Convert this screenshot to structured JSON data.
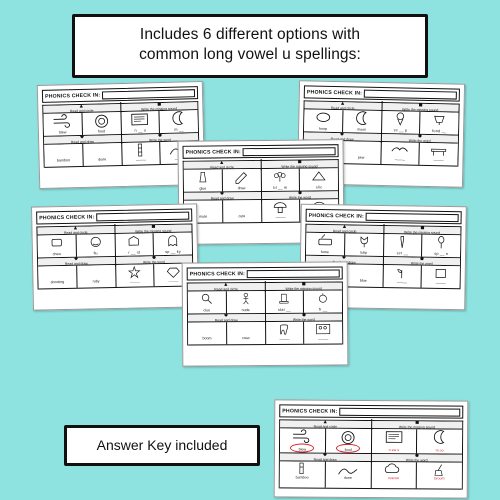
{
  "banner": {
    "line1": "Includes 6 different options with",
    "line2": "common long vowel u spellings:"
  },
  "answer_key": {
    "label": "Answer Key included"
  },
  "sheet_common": {
    "title": "PHONICS CHECK IN:",
    "header_read_circle": "Read and circle",
    "header_missing_sound": "Write the missing sound",
    "header_read_draw": "Read and draw",
    "header_write_word": "Write the word",
    "icons": {
      "triangle": "triangle-icon",
      "square": "square-icon",
      "heart": "heart-icon",
      "circle": "circle-icon"
    }
  },
  "sheets": [
    {
      "id": "sheet-ew",
      "top_words": [
        "blew",
        "food"
      ],
      "missing": [
        "n __ s",
        "m __"
      ],
      "bottom_words": [
        "bamboo",
        "dune"
      ],
      "top_pics": [
        "wind-blowing",
        "food-plate"
      ],
      "bottom_pics": [
        "bamboo",
        "sand-dune"
      ]
    },
    {
      "id": "sheet-oo",
      "top_words": [
        "hoop",
        "moon"
      ],
      "missing": [
        "sc __ p",
        "fond __"
      ],
      "bottom_words": [
        "flew",
        "pew"
      ],
      "top_pics": [
        "hoop",
        "moon"
      ],
      "bottom_pics": [
        "bird-flying",
        "bench"
      ]
    },
    {
      "id": "sheet-ue",
      "top_words": [
        "glue",
        "draw"
      ],
      "missing": [
        "bl __ m",
        "slic"
      ],
      "bottom_words": [
        "mute",
        "cute"
      ],
      "top_pics": [
        "glue-bottle",
        "drawing"
      ],
      "bottom_pics": [
        "mushroom",
        "mushroom-2"
      ]
    },
    {
      "id": "sheet-ew2",
      "top_words": [
        "chew",
        "flu"
      ],
      "missing": [
        "r __ st",
        "sp __ ky"
      ],
      "bottom_words": [
        "shooting",
        "ruby"
      ],
      "top_pics": [
        "chewing-gum",
        "sick-face"
      ],
      "bottom_pics": [
        "shooting-star",
        "ruby-gem"
      ]
    },
    {
      "id": "sheet-u-e",
      "top_words": [
        "fume",
        "tulip"
      ],
      "missing": [
        "scr __",
        "sp __ n"
      ],
      "bottom_words": [
        "grew",
        "blue"
      ],
      "top_pics": [
        "fumes",
        "tulip"
      ],
      "bottom_pics": [
        "plant-growing",
        "blue-swatch"
      ]
    },
    {
      "id": "sheet-ui",
      "top_words": [
        "clue",
        "nude"
      ],
      "missing": [
        "stat __",
        "fr __"
      ],
      "bottom_words": [
        "boom",
        "crew"
      ],
      "top_pics": [
        "magnifying-clue",
        "figure"
      ],
      "bottom_pics": [
        "tooth",
        "crew-group"
      ]
    }
  ],
  "answer_sheet": {
    "id": "sheet-answer-key",
    "title": "PHONICS CHECK IN:",
    "top_words": [
      "blew",
      "food"
    ],
    "answers": [
      "n ew s",
      "m oo"
    ],
    "bottom_words": [
      "bamboo",
      "dune"
    ],
    "bottom_answers": [
      "rescue",
      "broom"
    ],
    "accent": "#d4222a"
  }
}
